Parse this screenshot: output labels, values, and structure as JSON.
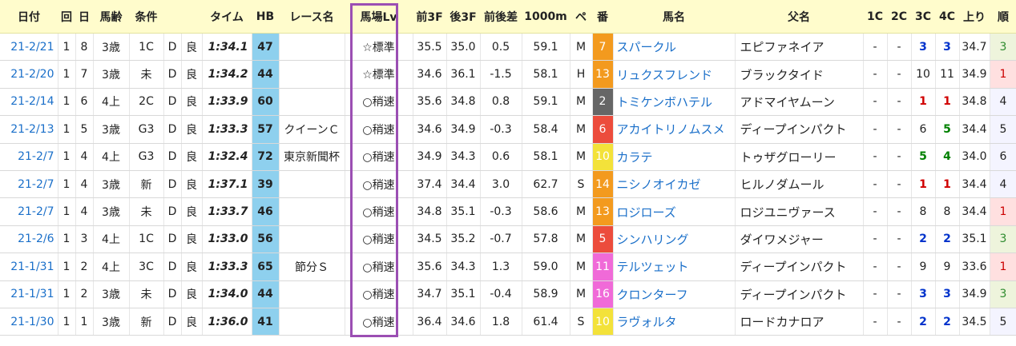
{
  "headers": {
    "date": "日付",
    "kai": "回",
    "day": "日",
    "age": "馬齢",
    "cond": "条件",
    "time": "タイム",
    "hb": "HB",
    "race": "レース名",
    "lv": "馬場Lv",
    "f3": "前3F",
    "l3": "後3F",
    "diff": "前後差",
    "p1000": "1000m",
    "pace": "ペ",
    "ban": "番",
    "name": "馬名",
    "sire": "父名",
    "c1": "1C",
    "c2": "2C",
    "c3": "3C",
    "c4": "4C",
    "agari": "上り",
    "rank": "順"
  },
  "rows": [
    {
      "date": "21-2/21",
      "kai": "1",
      "day": "8",
      "age": "3歳",
      "cond": "1C",
      "surf": "D",
      "going": "良",
      "time": "1:34.1",
      "hb": "47",
      "race": "",
      "lv": "☆標準",
      "f3": "35.5",
      "l3": "35.0",
      "diff": "0.5",
      "p1000": "59.1",
      "pace": "M",
      "ban": "7",
      "ban_color": "#f39a1e",
      "name": "スパークル",
      "sire": "エピファネイア",
      "c1": "-",
      "c2": "-",
      "c3": "3",
      "c4": "3",
      "c3c": "blue",
      "c4c": "blue",
      "agari": "34.7",
      "rank": "3"
    },
    {
      "date": "21-2/20",
      "kai": "1",
      "day": "7",
      "age": "3歳",
      "cond": "未",
      "surf": "D",
      "going": "良",
      "time": "1:34.2",
      "hb": "44",
      "race": "",
      "lv": "☆標準",
      "f3": "34.6",
      "l3": "36.1",
      "diff": "-1.5",
      "p1000": "58.1",
      "pace": "H",
      "ban": "13",
      "ban_color": "#f39a1e",
      "name": "リュクスフレンド",
      "sire": "ブラックタイド",
      "c1": "-",
      "c2": "-",
      "c3": "10",
      "c4": "11",
      "c3c": "",
      "c4c": "",
      "agari": "34.9",
      "rank": "1"
    },
    {
      "date": "21-2/14",
      "kai": "1",
      "day": "6",
      "age": "4上",
      "cond": "2C",
      "surf": "D",
      "going": "良",
      "time": "1:33.9",
      "hb": "60",
      "race": "",
      "lv": "○稍速",
      "f3": "35.6",
      "l3": "34.8",
      "diff": "0.8",
      "p1000": "59.1",
      "pace": "M",
      "ban": "2",
      "ban_color": "#666666",
      "name": "トミケンボハテル",
      "sire": "アドマイヤムーン",
      "c1": "-",
      "c2": "-",
      "c3": "1",
      "c4": "1",
      "c3c": "red",
      "c4c": "red",
      "agari": "34.8",
      "rank": "4"
    },
    {
      "date": "21-2/13",
      "kai": "1",
      "day": "5",
      "age": "3歳",
      "cond": "G3",
      "surf": "D",
      "going": "良",
      "time": "1:33.3",
      "hb": "57",
      "race": "クイーンＣ",
      "lv": "○稍速",
      "f3": "34.6",
      "l3": "34.9",
      "diff": "-0.3",
      "p1000": "58.4",
      "pace": "M",
      "ban": "6",
      "ban_color": "#ec4c3c",
      "name": "アカイトリノムスメ",
      "sire": "ディープインパクト",
      "c1": "-",
      "c2": "-",
      "c3": "6",
      "c4": "5",
      "c3c": "",
      "c4c": "green",
      "agari": "34.4",
      "rank": "5"
    },
    {
      "date": "21-2/7",
      "kai": "1",
      "day": "4",
      "age": "4上",
      "cond": "G3",
      "surf": "D",
      "going": "良",
      "time": "1:32.4",
      "hb": "72",
      "race": "東京新聞杯",
      "lv": "○稍速",
      "f3": "34.9",
      "l3": "34.3",
      "diff": "0.6",
      "p1000": "58.1",
      "pace": "M",
      "ban": "10",
      "ban_color": "#f3e23a",
      "name": "カラテ",
      "sire": "トゥザグローリー",
      "c1": "-",
      "c2": "-",
      "c3": "5",
      "c4": "4",
      "c3c": "green",
      "c4c": "green",
      "agari": "34.0",
      "rank": "6"
    },
    {
      "date": "21-2/7",
      "kai": "1",
      "day": "4",
      "age": "3歳",
      "cond": "新",
      "surf": "D",
      "going": "良",
      "time": "1:37.1",
      "hb": "39",
      "race": "",
      "lv": "○稍速",
      "f3": "37.4",
      "l3": "34.4",
      "diff": "3.0",
      "p1000": "62.7",
      "pace": "S",
      "ban": "14",
      "ban_color": "#f39a1e",
      "name": "ニシノオイカゼ",
      "sire": "ヒルノダムール",
      "c1": "-",
      "c2": "-",
      "c3": "1",
      "c4": "1",
      "c3c": "red",
      "c4c": "red",
      "agari": "34.4",
      "rank": "4"
    },
    {
      "date": "21-2/7",
      "kai": "1",
      "day": "4",
      "age": "3歳",
      "cond": "未",
      "surf": "D",
      "going": "良",
      "time": "1:33.7",
      "hb": "46",
      "race": "",
      "lv": "○稍速",
      "f3": "34.8",
      "l3": "35.1",
      "diff": "-0.3",
      "p1000": "58.6",
      "pace": "M",
      "ban": "13",
      "ban_color": "#f39a1e",
      "name": "ロジローズ",
      "sire": "ロジユニヴァース",
      "c1": "-",
      "c2": "-",
      "c3": "8",
      "c4": "8",
      "c3c": "",
      "c4c": "",
      "agari": "34.4",
      "rank": "1"
    },
    {
      "date": "21-2/6",
      "kai": "1",
      "day": "3",
      "age": "4上",
      "cond": "1C",
      "surf": "D",
      "going": "良",
      "time": "1:33.0",
      "hb": "56",
      "race": "",
      "lv": "○稍速",
      "f3": "34.5",
      "l3": "35.2",
      "diff": "-0.7",
      "p1000": "57.8",
      "pace": "M",
      "ban": "5",
      "ban_color": "#ec4c3c",
      "name": "シンハリング",
      "sire": "ダイワメジャー",
      "c1": "-",
      "c2": "-",
      "c3": "2",
      "c4": "2",
      "c3c": "blue",
      "c4c": "blue",
      "agari": "35.1",
      "rank": "3"
    },
    {
      "date": "21-1/31",
      "kai": "1",
      "day": "2",
      "age": "4上",
      "cond": "3C",
      "surf": "D",
      "going": "良",
      "time": "1:33.3",
      "hb": "65",
      "race": "節分Ｓ",
      "lv": "○稍速",
      "f3": "35.6",
      "l3": "34.3",
      "diff": "1.3",
      "p1000": "59.0",
      "pace": "M",
      "ban": "11",
      "ban_color": "#f06ad8",
      "name": "テルツェット",
      "sire": "ディープインパクト",
      "c1": "-",
      "c2": "-",
      "c3": "9",
      "c4": "9",
      "c3c": "",
      "c4c": "",
      "agari": "33.6",
      "rank": "1"
    },
    {
      "date": "21-1/31",
      "kai": "1",
      "day": "2",
      "age": "3歳",
      "cond": "未",
      "surf": "D",
      "going": "良",
      "time": "1:34.0",
      "hb": "44",
      "race": "",
      "lv": "○稍速",
      "f3": "34.7",
      "l3": "35.1",
      "diff": "-0.4",
      "p1000": "58.9",
      "pace": "M",
      "ban": "16",
      "ban_color": "#f06ad8",
      "name": "クロンターフ",
      "sire": "ディープインパクト",
      "c1": "-",
      "c2": "-",
      "c3": "3",
      "c4": "3",
      "c3c": "blue",
      "c4c": "blue",
      "agari": "34.9",
      "rank": "3"
    },
    {
      "date": "21-1/30",
      "kai": "1",
      "day": "1",
      "age": "3歳",
      "cond": "新",
      "surf": "D",
      "going": "良",
      "time": "1:36.0",
      "hb": "41",
      "race": "",
      "lv": "○稍速",
      "f3": "36.4",
      "l3": "34.6",
      "diff": "1.8",
      "p1000": "61.4",
      "pace": "S",
      "ban": "10",
      "ban_color": "#f3e23a",
      "name": "ラヴォルタ",
      "sire": "ロードカナロア",
      "c1": "-",
      "c2": "-",
      "c3": "2",
      "c4": "2",
      "c3c": "blue",
      "c4c": "blue",
      "agari": "34.5",
      "rank": "5"
    }
  ]
}
